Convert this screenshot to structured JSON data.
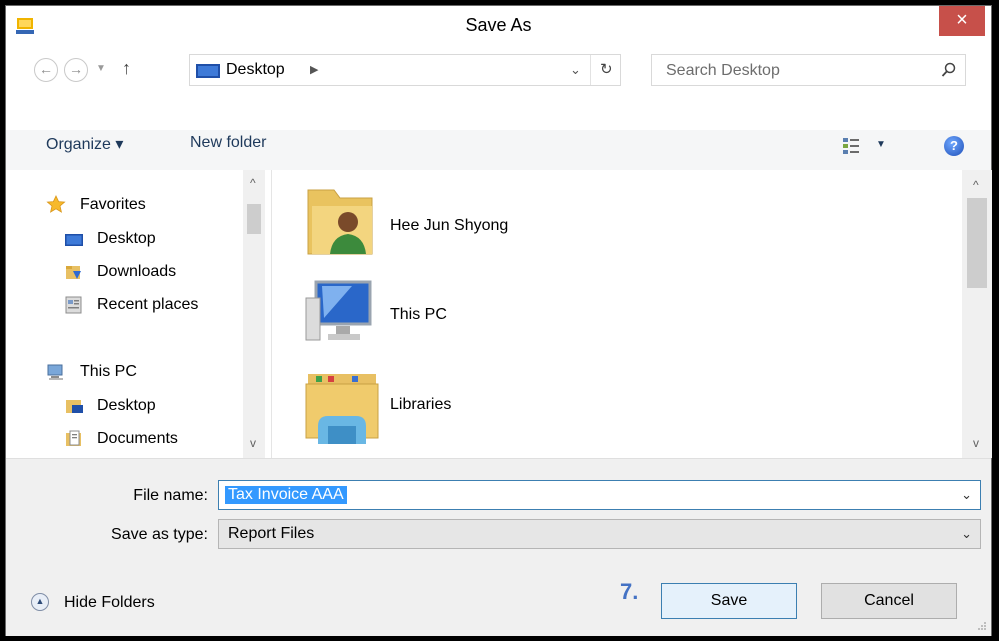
{
  "window": {
    "title": "Save As",
    "close_label": "×"
  },
  "navigation": {
    "back": "←",
    "forward": "→",
    "dropdown": "▼",
    "up": "↑",
    "address": "Desktop",
    "address_arrow": "▶",
    "address_dropdown": "⌄",
    "refresh": "↻",
    "search_placeholder": "Search Desktop"
  },
  "toolbar": {
    "organize": "Organize ▾",
    "new_folder": "New folder",
    "view_dropdown": "▼",
    "help": "?"
  },
  "nav_pane": {
    "items": [
      {
        "label": "Favorites",
        "icon": "star-icon"
      },
      {
        "label": "Desktop",
        "icon": "desktop-icon"
      },
      {
        "label": "Downloads",
        "icon": "downloads-icon"
      },
      {
        "label": "Recent places",
        "icon": "recent-places-icon"
      },
      {
        "label": "This PC",
        "icon": "computer-icon"
      },
      {
        "label": "Desktop",
        "icon": "desktop-folder-icon"
      },
      {
        "label": "Documents",
        "icon": "documents-icon"
      }
    ],
    "scroll_up": "^",
    "scroll_down": "v"
  },
  "content": {
    "items": [
      {
        "label": "Hee Jun Shyong",
        "icon": "user-folder-icon"
      },
      {
        "label": "This PC",
        "icon": "computer-icon"
      },
      {
        "label": "Libraries",
        "icon": "libraries-icon"
      }
    ],
    "scroll_up": "^",
    "scroll_down": "v"
  },
  "form": {
    "file_name_label": "File name:",
    "file_name_value": "Tax Invoice AAA",
    "save_type_label": "Save as type:",
    "save_type_value": "Report Files",
    "dropdown": "⌄"
  },
  "footer": {
    "hide_folders": "Hide Folders",
    "step_marker": "7.",
    "save": "Save",
    "cancel": "Cancel"
  },
  "colors": {
    "close_button": "#c7504a",
    "selection": "#3399ff",
    "step_marker": "#4472c4",
    "link_text": "#1e395b"
  }
}
